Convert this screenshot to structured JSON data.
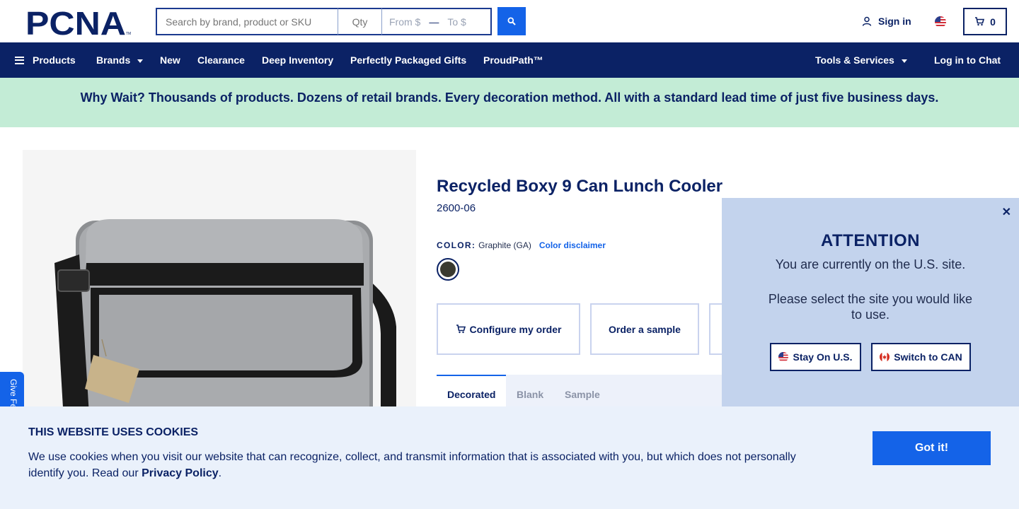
{
  "brand": {
    "logo_text": "PCNA",
    "trademark": "TM"
  },
  "search": {
    "placeholder": "Search by brand, product or SKU",
    "qty_placeholder": "Qty",
    "price_from_placeholder": "From $",
    "price_to_placeholder": "To $",
    "range_separator": "—",
    "button_icon": "search-icon"
  },
  "header": {
    "sign_in_label": "Sign in",
    "cart_count": "0",
    "region_flag": "us-flag-icon"
  },
  "nav": {
    "products_label": "Products",
    "brands_label": "Brands",
    "new_label": "New",
    "clearance_label": "Clearance",
    "deep_inventory_label": "Deep Inventory",
    "gifts_label": "Perfectly Packaged Gifts",
    "proudpath_label": "ProudPath™",
    "tools_label": "Tools & Services",
    "chat_label": "Log in to Chat"
  },
  "promo": {
    "text": "Why Wait? Thousands of products. Dozens of retail brands. Every decoration method. All with a standard lead time of just five business days."
  },
  "product": {
    "title": "Recycled Boxy 9 Can Lunch Cooler",
    "sku": "2600-06",
    "color_label": "COLOR:",
    "color_value": "Graphite (GA)",
    "color_disclaimer": "Color disclaimer",
    "configure_label": "Configure my order",
    "sample_label": "Order a sample",
    "tabs": [
      "Decorated",
      "Blank",
      "Sample"
    ]
  },
  "feedback": {
    "label": "Give Feedback"
  },
  "attention": {
    "title": "ATTENTION",
    "line1": "You are currently on the U.S. site.",
    "line2": "Please select the site you would like to use.",
    "stay_label": "Stay On U.S.",
    "switch_label": "Switch to CAN",
    "close_symbol": "✕"
  },
  "cookie": {
    "title": "THIS WEBSITE USES COOKIES",
    "text": "We use cookies when you visit our website that can recognize, collect, and transmit information that is associated with you, but which does not personally identify you. Read our",
    "link": "Privacy Policy",
    "period": ".",
    "button": "Got it!"
  },
  "colors": {
    "navy": "#0b2265",
    "accent_blue": "#1463e8",
    "promo_green": "#c3ecd6",
    "popup_blue": "#c3d3ed",
    "cookie_bg": "#eaf1fb",
    "swatch_graphite": "#3a3a30"
  }
}
